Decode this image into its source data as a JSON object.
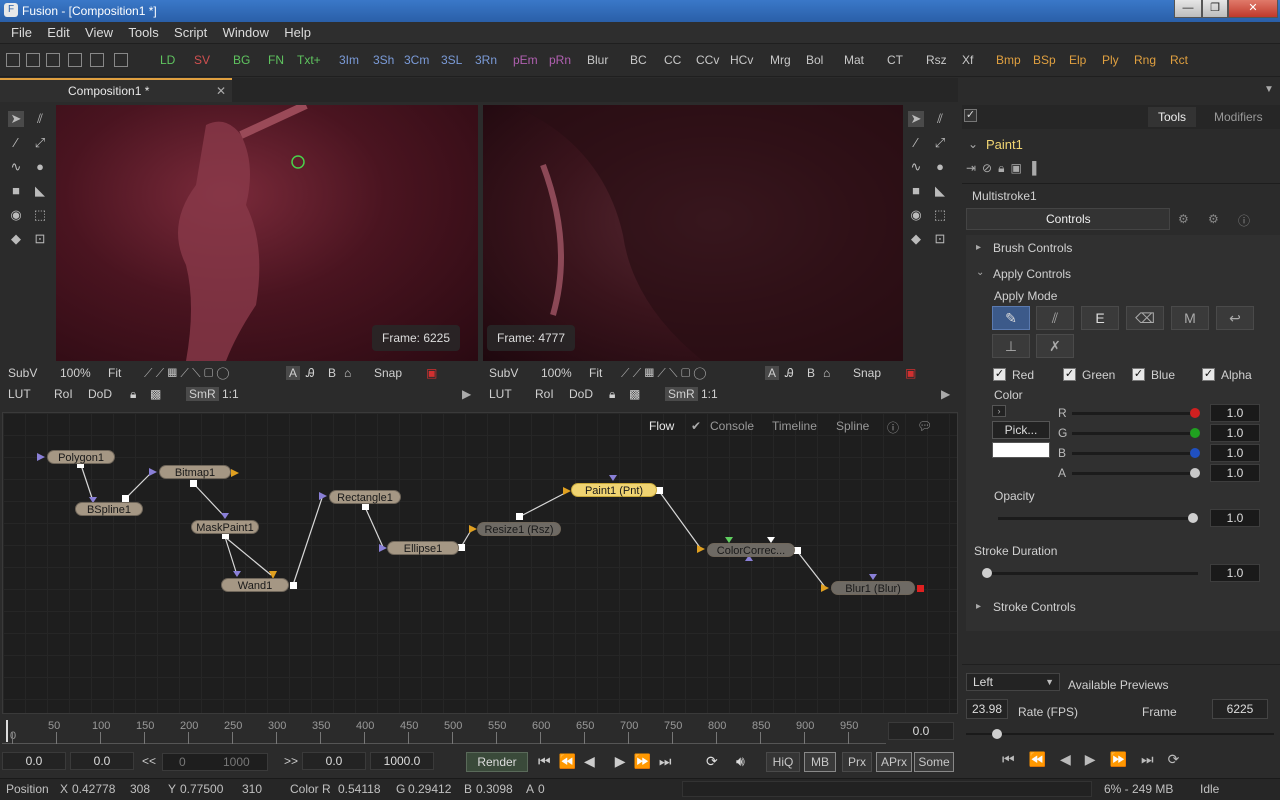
{
  "window": {
    "title": "Fusion - [Composition1 *]"
  },
  "menu": [
    "File",
    "Edit",
    "View",
    "Tools",
    "Script",
    "Window",
    "Help"
  ],
  "toolbar": {
    "items": [
      {
        "label": "LD",
        "color": "#5fc35f"
      },
      {
        "label": "SV",
        "color": "#d05050"
      },
      {
        "label": "BG",
        "color": "#5fc35f"
      },
      {
        "label": "FN",
        "color": "#5fc35f"
      },
      {
        "label": "Txt+",
        "color": "#5fc35f"
      },
      {
        "label": "3Im",
        "color": "#7b9bd8"
      },
      {
        "label": "3Sh",
        "color": "#7b9bd8"
      },
      {
        "label": "3Cm",
        "color": "#7b9bd8"
      },
      {
        "label": "3SL",
        "color": "#7b9bd8"
      },
      {
        "label": "3Rn",
        "color": "#7b9bd8"
      },
      {
        "label": "pEm",
        "color": "#b060b0"
      },
      {
        "label": "pRn",
        "color": "#b060b0"
      },
      {
        "label": "Blur",
        "color": "#c8c8c8"
      },
      {
        "label": "BC",
        "color": "#c8c8c8"
      },
      {
        "label": "CC",
        "color": "#c8c8c8"
      },
      {
        "label": "CCv",
        "color": "#c8c8c8"
      },
      {
        "label": "HCv",
        "color": "#c8c8c8"
      },
      {
        "label": "Mrg",
        "color": "#c8c8c8"
      },
      {
        "label": "Bol",
        "color": "#c8c8c8"
      },
      {
        "label": "Mat",
        "color": "#c8c8c8"
      },
      {
        "label": "CT",
        "color": "#c8c8c8"
      },
      {
        "label": "Rsz",
        "color": "#c8c8c8"
      },
      {
        "label": "Xf",
        "color": "#c8c8c8"
      },
      {
        "label": "Bmp",
        "color": "#e0a040"
      },
      {
        "label": "BSp",
        "color": "#e0a040"
      },
      {
        "label": "Elp",
        "color": "#e0a040"
      },
      {
        "label": "Ply",
        "color": "#e0a040"
      },
      {
        "label": "Rng",
        "color": "#e0a040"
      },
      {
        "label": "Rct",
        "color": "#e0a040"
      }
    ]
  },
  "tabs": {
    "composition": "Composition1 *"
  },
  "viewers": {
    "left": {
      "frame": "Frame: 6225",
      "bar1": [
        "SubV",
        "100%",
        "Fit",
        "Snap"
      ],
      "bar2": [
        "LUT",
        "RoI",
        "DoD",
        "SmR",
        "1:1"
      ]
    },
    "right": {
      "frame": "Frame: 4777",
      "bar1": [
        "SubV",
        "100%",
        "Fit",
        "Snap"
      ],
      "bar2": [
        "LUT",
        "RoI",
        "DoD",
        "SmR",
        "1:1"
      ]
    }
  },
  "flow": {
    "tabs": [
      "Flow",
      "Console",
      "Timeline",
      "Spline"
    ],
    "nodes": {
      "polygon": "Polygon1",
      "bspline": "BSpline1",
      "bitmap": "Bitmap1",
      "maskpaint": "MaskPaint1",
      "wand": "Wand1",
      "rectangle": "Rectangle1",
      "ellipse": "Ellipse1",
      "resize": "Resize1  (Rsz)",
      "paint": "Paint1  (Pnt)",
      "colorcorrector": "ColorCorrec...",
      "blur": "Blur1  (Blur)"
    }
  },
  "inspector": {
    "tabs": [
      "Tools",
      "Modifiers"
    ],
    "tool_name": "Paint1",
    "modifier": "Multistroke1",
    "controls_tab": "Controls",
    "brush_controls": "Brush Controls",
    "apply_controls": "Apply Controls",
    "apply_mode": "Apply Mode",
    "channels": [
      "Red",
      "Green",
      "Blue",
      "Alpha"
    ],
    "color_label": "Color",
    "pick_label": "Pick...",
    "rgba": [
      {
        "ch": "R",
        "value": "1.0",
        "color": "#d02020"
      },
      {
        "ch": "G",
        "value": "1.0",
        "color": "#20a020"
      },
      {
        "ch": "B",
        "value": "1.0",
        "color": "#2050c0"
      },
      {
        "ch": "A",
        "value": "1.0",
        "color": "#c8c8c8"
      }
    ],
    "opacity_label": "Opacity",
    "opacity_value": "1.0",
    "stroke_duration_label": "Stroke Duration",
    "stroke_duration_value": "1.0",
    "stroke_controls": "Stroke Controls"
  },
  "previews": {
    "left_select": "Left",
    "available": "Available Previews",
    "rate_value": "23.98",
    "rate_label": "Rate (FPS)",
    "frame_label": "Frame",
    "frame_value": "6225"
  },
  "timeline": {
    "ticks": [
      "0",
      "50",
      "100",
      "150",
      "200",
      "250",
      "300",
      "350",
      "400",
      "450",
      "500",
      "550",
      "600",
      "650",
      "700",
      "750",
      "800",
      "850",
      "900",
      "950"
    ],
    "current": "0.0",
    "start": "0.0",
    "render_start": "0.0",
    "back": "<<",
    "range_start": "0",
    "range_end": "1000",
    "fwd": ">>",
    "render_end": "0.0",
    "end": "1000.0",
    "render_label": "Render",
    "buttons": [
      "HiQ",
      "MB",
      "Prx",
      "APrx",
      "Some"
    ]
  },
  "status": {
    "position_label": "Position",
    "x_label": "X",
    "x": "0.42778",
    "px": "308",
    "y_label": "Y",
    "y": "0.77500",
    "py": "310",
    "color_label": "Color R",
    "r": "0.54118",
    "g_label": "G",
    "g": "0.29412",
    "b_label": "B",
    "b": "0.3098",
    "a_label": "A",
    "a": "0",
    "memory": "6% - 249 MB",
    "state": "Idle"
  }
}
